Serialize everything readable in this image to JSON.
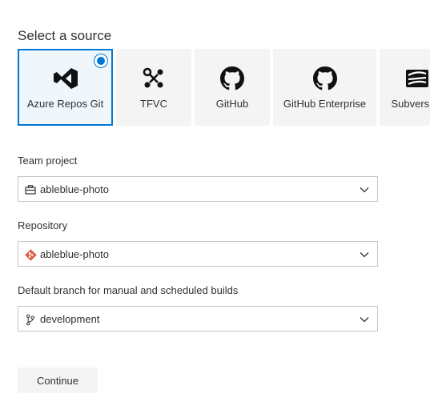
{
  "heading": "Select a source",
  "sources": [
    {
      "label": "Azure Repos Git",
      "icon": "azure-repos-icon",
      "selected": true
    },
    {
      "label": "TFVC",
      "icon": "tfvc-icon",
      "selected": false
    },
    {
      "label": "GitHub",
      "icon": "github-icon",
      "selected": false
    },
    {
      "label": "GitHub Enterprise",
      "icon": "github-icon",
      "selected": false
    },
    {
      "label": "Subversion",
      "icon": "subversion-icon",
      "selected": false
    }
  ],
  "team_project": {
    "label": "Team project",
    "value": "ableblue-photo",
    "icon": "project-icon"
  },
  "repository": {
    "label": "Repository",
    "value": "ableblue-photo",
    "icon": "git-repo-icon"
  },
  "branch": {
    "label": "Default branch for manual and scheduled builds",
    "value": "development",
    "icon": "branch-icon"
  },
  "continue_label": "Continue",
  "colors": {
    "accent": "#0078d4",
    "tile_bg": "#f4f4f4",
    "git_orange": "#e05d44"
  }
}
